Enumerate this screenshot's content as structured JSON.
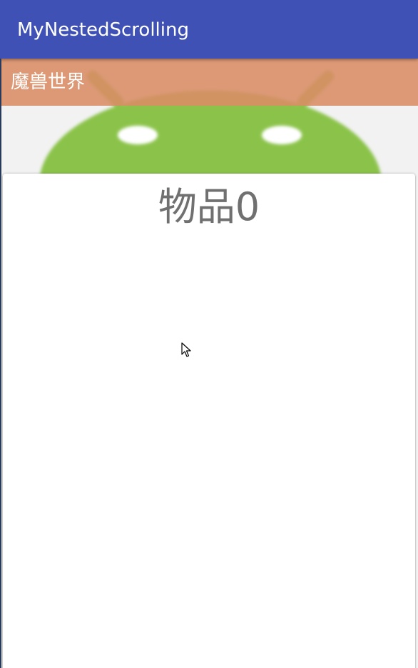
{
  "app_bar": {
    "title": "MyNestedScrolling",
    "color": "#3f51b5"
  },
  "header": {
    "banner_title": "魔兽世界",
    "banner_color": "#da8c64",
    "image": "android-robot-image"
  },
  "card": {
    "title": "物品0"
  },
  "cursor": {
    "icon": "mouse-pointer-icon"
  }
}
